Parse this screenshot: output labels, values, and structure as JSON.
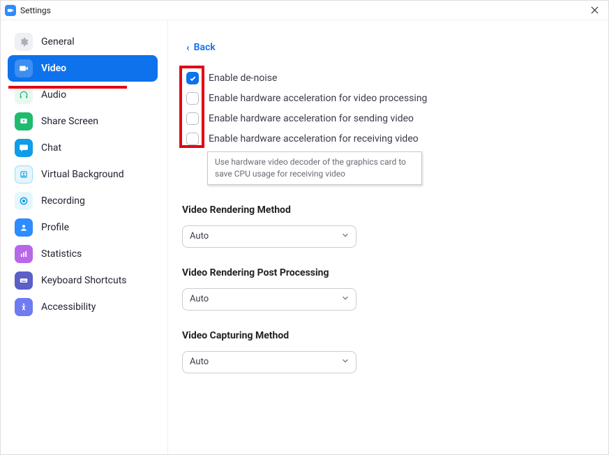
{
  "window": {
    "title": "Settings"
  },
  "sidebar": {
    "items": [
      {
        "label": "General"
      },
      {
        "label": "Video"
      },
      {
        "label": "Audio"
      },
      {
        "label": "Share Screen"
      },
      {
        "label": "Chat"
      },
      {
        "label": "Virtual Background"
      },
      {
        "label": "Recording"
      },
      {
        "label": "Profile"
      },
      {
        "label": "Statistics"
      },
      {
        "label": "Keyboard Shortcuts"
      },
      {
        "label": "Accessibility"
      }
    ],
    "active_index": 1
  },
  "main": {
    "back_label": "Back",
    "checkboxes": [
      {
        "label": "Enable de-noise",
        "checked": true
      },
      {
        "label": "Enable hardware acceleration for video processing",
        "checked": false
      },
      {
        "label": "Enable hardware acceleration for sending video",
        "checked": false
      },
      {
        "label": "Enable hardware acceleration for receiving video",
        "checked": false
      }
    ],
    "tooltip": "Use hardware video decoder of the graphics card to save CPU usage for receiving video",
    "sections": [
      {
        "title": "Video Rendering Method",
        "value": "Auto"
      },
      {
        "title": "Video Rendering Post Processing",
        "value": "Auto"
      },
      {
        "title": "Video Capturing Method",
        "value": "Auto"
      }
    ]
  },
  "annotation": {
    "red_box_target": "checkboxes column",
    "red_underline_target": "Video sidebar item"
  }
}
